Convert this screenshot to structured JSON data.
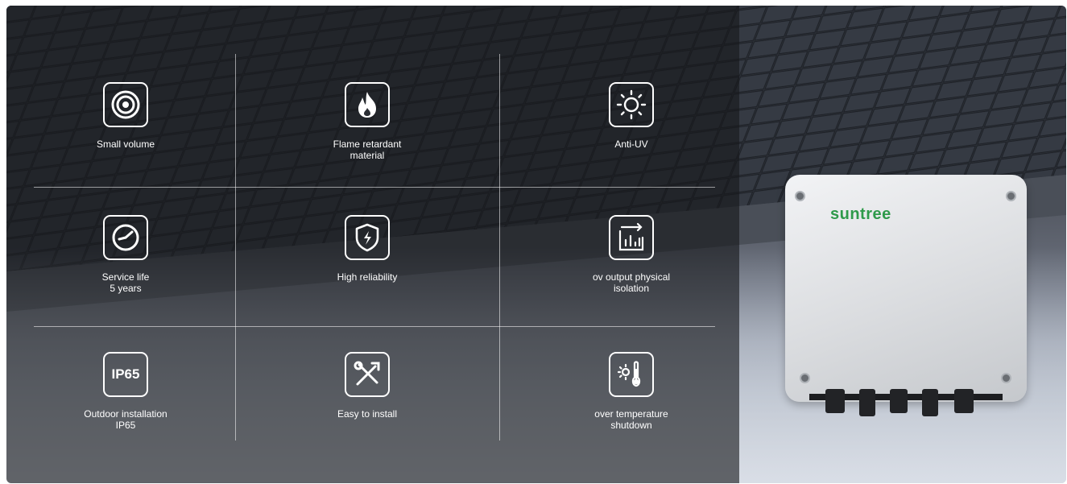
{
  "features": [
    {
      "label": "Small volume",
      "icon": "concentric-circles-icon"
    },
    {
      "label": "Flame retardant\nmaterial",
      "icon": "flame-icon"
    },
    {
      "label": "Anti-UV",
      "icon": "sun-icon"
    },
    {
      "label": "Service life\n5 years",
      "icon": "gauge-icon"
    },
    {
      "label": "High reliability",
      "icon": "shield-lightning-icon"
    },
    {
      "label": "ov output physical\nisolation",
      "icon": "bar-chart-arrow-icon"
    },
    {
      "label": "Outdoor installation\nIP65",
      "icon": "ip65-badge-icon",
      "badge_text": "IP65"
    },
    {
      "label": "Easy to install",
      "icon": "tools-icon"
    },
    {
      "label": "over temperature\nshutdown",
      "icon": "thermometer-sun-icon"
    }
  ],
  "product": {
    "brand": "suntree",
    "brand_color": "#2e9a4a"
  }
}
